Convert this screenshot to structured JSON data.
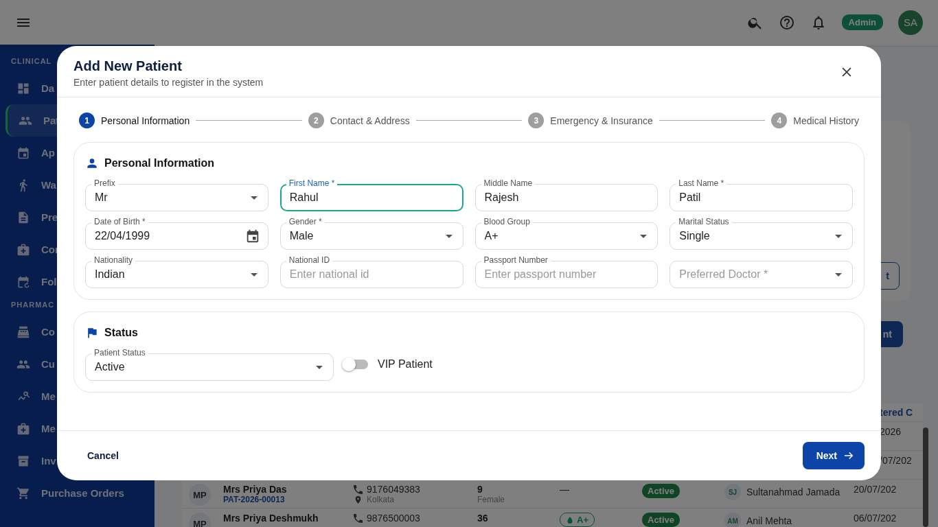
{
  "top_bar": {
    "role_badge": "Admin",
    "avatar": "SA"
  },
  "sidebar": {
    "sections": [
      {
        "title": "CLINICAL",
        "items": [
          {
            "label": "Da",
            "selected": false
          },
          {
            "label": "Pat",
            "selected": true
          },
          {
            "label": "Ap",
            "selected": false
          },
          {
            "label": "Wa",
            "selected": false
          },
          {
            "label": "Pre",
            "selected": false
          },
          {
            "label": "Cor",
            "selected": false
          },
          {
            "label": "Fol",
            "selected": false
          }
        ]
      },
      {
        "title": "PHARMAC",
        "items": [
          {
            "label": "Co",
            "selected": false
          },
          {
            "label": "Cu",
            "selected": false
          },
          {
            "label": "Me",
            "selected": false
          },
          {
            "label": "Me",
            "selected": false
          },
          {
            "label": "Inv",
            "selected": false
          },
          {
            "label": "Purchase Orders",
            "selected": false
          }
        ]
      }
    ]
  },
  "page": {
    "card_button": "t",
    "action_button": "nt",
    "table": {
      "column_8": "tered C",
      "rows": [
        {
          "date": "2026"
        },
        {
          "date": "/07/202"
        },
        {
          "initials": "MP",
          "name": "Mrs Priya Das",
          "patient_id": "PAT-2026-00013",
          "phone": "9176049383",
          "city": "Kolkata",
          "age": "9",
          "gender": "Female",
          "blood": "—",
          "status": "Active",
          "doctor_initials": "SJ",
          "doctor": "Sultanahmad Jamada",
          "date": "20/07/202"
        },
        {
          "initials": "MP",
          "name": "Mrs Priya Deshmukh",
          "phone": "9876500003",
          "age": "36",
          "blood_tag": "A+",
          "status": "Active",
          "doctor_initials": "AM",
          "doctor": "Anil Mehta",
          "date": "06/07/202"
        }
      ]
    }
  },
  "dialog": {
    "title": "Add New Patient",
    "subtitle": "Enter patient details to register in the system",
    "steps": [
      {
        "number": "1",
        "label": "Personal Information",
        "selected": true
      },
      {
        "number": "2",
        "label": "Contact & Address",
        "selected": false
      },
      {
        "number": "3",
        "label": "Emergency & Insurance",
        "selected": false
      },
      {
        "number": "4",
        "label": "Medical History",
        "selected": false
      }
    ],
    "sections": [
      {
        "title": "Personal Information",
        "fields": [
          {
            "kind": "select",
            "label": "Prefix",
            "value": "Mr",
            "focused": false
          },
          {
            "kind": "text",
            "label": "First Name *",
            "value": "Rahul",
            "focused": true
          },
          {
            "kind": "text",
            "label": "Middle Name",
            "value": "Rajesh",
            "focused": false
          },
          {
            "kind": "text",
            "label": "Last Name *",
            "value": "Patil",
            "focused": false
          },
          {
            "kind": "date",
            "label": "Date of Birth *",
            "value": "22/04/1999",
            "focused": false
          },
          {
            "kind": "select",
            "label": "Gender *",
            "value": "Male",
            "focused": false
          },
          {
            "kind": "select",
            "label": "Blood Group",
            "value": "A+",
            "focused": false
          },
          {
            "kind": "select",
            "label": "Marital Status",
            "value": "Single",
            "focused": false
          },
          {
            "kind": "select",
            "label": "Nationality",
            "value": "Indian",
            "focused": false
          },
          {
            "kind": "text",
            "label": "National ID",
            "placeholder": "Enter national id",
            "focused": false
          },
          {
            "kind": "text",
            "label": "Passport Number",
            "placeholder": "Enter passport number",
            "focused": false
          },
          {
            "kind": "select",
            "placeholder": "Preferred Doctor *",
            "focused": false
          }
        ]
      },
      {
        "title": "Status",
        "fields": [
          {
            "kind": "select",
            "label": "Patient Status",
            "value": "Active",
            "focused": false
          },
          {
            "kind": "toggle",
            "label": "VIP Patient",
            "on": false
          }
        ]
      }
    ],
    "cancel": "Cancel",
    "next": "Next"
  }
}
